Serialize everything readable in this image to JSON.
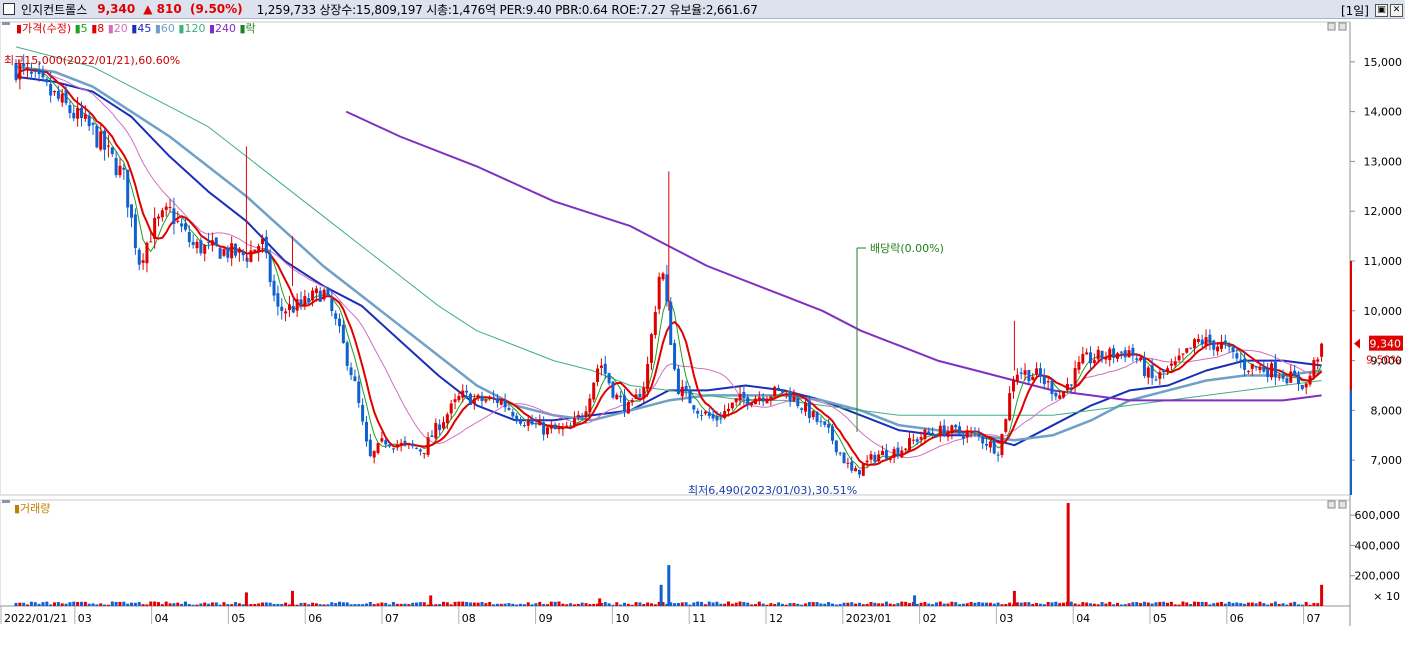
{
  "header": {
    "stock_name": "인지컨트롤스",
    "price": "9,340",
    "change": "▲ 810",
    "change_pct": "(9.50%)",
    "info": "1,259,733  상장수:15,809,197 시총:1,476억  PER:9.40 PBR:0.64 ROE:7.27 유보율:2,661.67",
    "period": "[1일]"
  },
  "legend": {
    "price": {
      "label": "가격(수정)",
      "color": "#e00000"
    },
    "ma": [
      {
        "label": "5",
        "color": "#20a020"
      },
      {
        "label": "8",
        "color": "#e00000"
      },
      {
        "label": "20",
        "color": "#d070c0"
      },
      {
        "label": "45",
        "color": "#1a2fb8"
      },
      {
        "label": "60",
        "color": "#6fa0c8"
      },
      {
        "label": "120",
        "color": "#40b080"
      },
      {
        "label": "240",
        "color": "#8030c0"
      },
      {
        "label": "락",
        "color": "#208020"
      }
    ],
    "volume": {
      "label": "거래량",
      "color": "#c08000"
    }
  },
  "annotations": {
    "high": "최고15,000(2022/01/21),60.60%",
    "low": "최저6,490(2023/01/03),30.51%",
    "dividend": "배당락(0.00%)"
  },
  "colors": {
    "up": "#e00000",
    "down": "#1060d0",
    "ma240": "#8030c0",
    "ma45": "#1a2fb8",
    "ma60": "#6fa0c8",
    "ma120": "#40b080",
    "ma20": "#d070c0",
    "ma5": "#20a020",
    "ma8": "#e00000"
  },
  "chart_data": [
    {
      "type": "candlestick",
      "title": "인지컨트롤스",
      "x": [
        "2022/01/21",
        "03",
        "04",
        "05",
        "06",
        "07",
        "08",
        "09",
        "10",
        "11",
        "12",
        "2023/01",
        "02",
        "03",
        "04",
        "05",
        "06",
        "07"
      ],
      "ylim": [
        6300,
        15800
      ],
      "yticks": [
        "15,000",
        "14,000",
        "13,000",
        "12,000",
        "11,000",
        "10,000",
        "9,000",
        "8,000",
        "7,000"
      ],
      "current_price_label": "9,340",
      "current_change_label": "9.50%",
      "close_path": [
        [
          0,
          14900
        ],
        [
          0.5,
          14300
        ],
        [
          1,
          13600
        ],
        [
          1.4,
          12700
        ],
        [
          1.6,
          11000
        ],
        [
          1.8,
          11700
        ],
        [
          2,
          12000
        ],
        [
          2.3,
          11300
        ],
        [
          2.7,
          11200
        ],
        [
          3,
          11100
        ],
        [
          3.2,
          11400
        ],
        [
          3.4,
          10000
        ],
        [
          3.7,
          10100
        ],
        [
          4,
          10400
        ],
        [
          4.2,
          9600
        ],
        [
          4.4,
          8600
        ],
        [
          4.6,
          7000
        ],
        [
          4.8,
          7400
        ],
        [
          5,
          7300
        ],
        [
          5.3,
          7200
        ],
        [
          5.5,
          7700
        ],
        [
          5.8,
          8300
        ],
        [
          6,
          8200
        ],
        [
          6.3,
          8200
        ],
        [
          6.6,
          7800
        ],
        [
          6.9,
          7600
        ],
        [
          7.2,
          7600
        ],
        [
          7.4,
          8000
        ],
        [
          7.6,
          9000
        ],
        [
          7.8,
          8300
        ],
        [
          8,
          8000
        ],
        [
          8.2,
          8600
        ],
        [
          8.4,
          11000
        ],
        [
          8.6,
          8500
        ],
        [
          8.9,
          8000
        ],
        [
          9.1,
          7800
        ],
        [
          9.4,
          8200
        ],
        [
          9.7,
          8300
        ],
        [
          10,
          8400
        ],
        [
          10.3,
          8000
        ],
        [
          10.6,
          7500
        ],
        [
          10.9,
          6700
        ],
        [
          11.2,
          7100
        ],
        [
          11.5,
          7200
        ],
        [
          11.8,
          7500
        ],
        [
          12.1,
          7600
        ],
        [
          12.5,
          7500
        ],
        [
          12.8,
          7200
        ],
        [
          13,
          8800
        ],
        [
          13.3,
          8700
        ],
        [
          13.6,
          8300
        ],
        [
          13.9,
          9000
        ],
        [
          14.2,
          9100
        ],
        [
          14.5,
          9200
        ],
        [
          14.8,
          8600
        ],
        [
          15.1,
          8900
        ],
        [
          15.4,
          9400
        ],
        [
          15.7,
          9300
        ],
        [
          16,
          8900
        ],
        [
          16.4,
          8800
        ],
        [
          16.8,
          8500
        ],
        [
          17,
          9340
        ]
      ],
      "ma_series": [
        {
          "name": "45",
          "points": [
            [
              0,
              14700
            ],
            [
              0.5,
              14600
            ],
            [
              1,
              14400
            ],
            [
              1.5,
              13900
            ],
            [
              2,
              13100
            ],
            [
              2.5,
              12400
            ],
            [
              3,
              11800
            ],
            [
              3.5,
              11000
            ],
            [
              4,
              10500
            ],
            [
              4.5,
              10100
            ],
            [
              5,
              9400
            ],
            [
              5.5,
              8700
            ],
            [
              6,
              8100
            ],
            [
              6.5,
              7800
            ],
            [
              7,
              7800
            ],
            [
              7.5,
              7900
            ],
            [
              8,
              8000
            ],
            [
              8.5,
              8400
            ],
            [
              9,
              8400
            ],
            [
              9.5,
              8500
            ],
            [
              10,
              8400
            ],
            [
              10.5,
              8200
            ],
            [
              11,
              7900
            ],
            [
              11.5,
              7600
            ],
            [
              12,
              7500
            ],
            [
              12.5,
              7500
            ],
            [
              13,
              7300
            ],
            [
              13.5,
              7700
            ],
            [
              14,
              8100
            ],
            [
              14.5,
              8400
            ],
            [
              15,
              8500
            ],
            [
              15.5,
              8800
            ],
            [
              16,
              9000
            ],
            [
              16.5,
              9000
            ],
            [
              17,
              8900
            ]
          ]
        },
        {
          "name": "60",
          "points": [
            [
              0,
              14900
            ],
            [
              0.5,
              14800
            ],
            [
              1,
              14500
            ],
            [
              1.5,
              14000
            ],
            [
              2,
              13500
            ],
            [
              2.5,
              12900
            ],
            [
              3,
              12300
            ],
            [
              3.5,
              11600
            ],
            [
              4,
              10900
            ],
            [
              4.5,
              10300
            ],
            [
              5,
              9700
            ],
            [
              5.5,
              9100
            ],
            [
              6,
              8500
            ],
            [
              6.5,
              8100
            ],
            [
              7,
              7900
            ],
            [
              7.5,
              7800
            ],
            [
              8,
              8000
            ],
            [
              8.5,
              8200
            ],
            [
              9,
              8300
            ],
            [
              9.5,
              8300
            ],
            [
              10,
              8300
            ],
            [
              10.5,
              8200
            ],
            [
              11,
              8000
            ],
            [
              11.5,
              7700
            ],
            [
              12,
              7600
            ],
            [
              12.5,
              7500
            ],
            [
              13,
              7400
            ],
            [
              13.5,
              7500
            ],
            [
              14,
              7800
            ],
            [
              14.5,
              8200
            ],
            [
              15,
              8400
            ],
            [
              15.5,
              8600
            ],
            [
              16,
              8700
            ],
            [
              16.5,
              8700
            ],
            [
              17,
              8800
            ]
          ]
        },
        {
          "name": "120",
          "points": [
            [
              0,
              15300
            ],
            [
              1,
              14900
            ],
            [
              2,
              14100
            ],
            [
              2.5,
              13700
            ],
            [
              3,
              13100
            ],
            [
              3.5,
              12500
            ],
            [
              4,
              11900
            ],
            [
              4.5,
              11300
            ],
            [
              5,
              10700
            ],
            [
              5.5,
              10100
            ],
            [
              6,
              9600
            ],
            [
              6.5,
              9300
            ],
            [
              7,
              9000
            ],
            [
              7.5,
              8800
            ],
            [
              8,
              8500
            ],
            [
              8.5,
              8400
            ],
            [
              9,
              8300
            ],
            [
              9.5,
              8200
            ],
            [
              10,
              8200
            ],
            [
              10.5,
              8100
            ],
            [
              11,
              8000
            ],
            [
              11.5,
              7900
            ],
            [
              12,
              7900
            ],
            [
              12.5,
              7900
            ],
            [
              13,
              7900
            ],
            [
              13.5,
              7900
            ],
            [
              14,
              8000
            ],
            [
              14.5,
              8100
            ],
            [
              15,
              8200
            ],
            [
              15.5,
              8300
            ],
            [
              16,
              8400
            ],
            [
              16.5,
              8500
            ],
            [
              17,
              8600
            ]
          ]
        },
        {
          "name": "240",
          "points": [
            [
              4.3,
              14000
            ],
            [
              5,
              13500
            ],
            [
              6,
              12900
            ],
            [
              7,
              12200
            ],
            [
              8,
              11700
            ],
            [
              8.5,
              11300
            ],
            [
              9,
              10900
            ],
            [
              10,
              10300
            ],
            [
              10.5,
              10000
            ],
            [
              11,
              9600
            ],
            [
              11.5,
              9300
            ],
            [
              12,
              9000
            ],
            [
              12.5,
              8800
            ],
            [
              13,
              8600
            ],
            [
              13.5,
              8400
            ],
            [
              14,
              8300
            ],
            [
              14.5,
              8200
            ],
            [
              15,
              8200
            ],
            [
              15.5,
              8200
            ],
            [
              16,
              8200
            ],
            [
              16.5,
              8200
            ],
            [
              17,
              8300
            ]
          ]
        }
      ]
    },
    {
      "type": "bar",
      "title": "거래량",
      "ylim": [
        0,
        700000
      ],
      "yticks": [
        "600,000",
        "400,000",
        "200,000"
      ],
      "unit_label": "× 10",
      "spikes": [
        {
          "x": 3.0,
          "value": 90000,
          "dir": "up"
        },
        {
          "x": 3.6,
          "value": 100000,
          "dir": "up"
        },
        {
          "x": 5.4,
          "value": 70000,
          "dir": "up"
        },
        {
          "x": 7.6,
          "value": 50000,
          "dir": "up"
        },
        {
          "x": 8.4,
          "value": 140000,
          "dir": "down"
        },
        {
          "x": 8.5,
          "value": 270000,
          "dir": "down"
        },
        {
          "x": 11.7,
          "value": 70000,
          "dir": "down"
        },
        {
          "x": 13.0,
          "value": 100000,
          "dir": "up"
        },
        {
          "x": 13.7,
          "value": 680000,
          "dir": "up"
        },
        {
          "x": 17.0,
          "value": 140000,
          "dir": "up"
        }
      ]
    }
  ]
}
